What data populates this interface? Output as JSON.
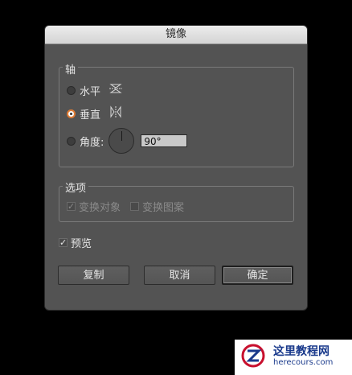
{
  "dialog": {
    "title": "镜像",
    "axis_group": {
      "title": "轴",
      "horizontal_label": "水平",
      "vertical_label": "垂直",
      "angle_label": "角度:",
      "angle_value": "90°",
      "selected": "vertical"
    },
    "options_group": {
      "title": "选项",
      "transform_objects_label": "变换对象",
      "transform_objects_checked": true,
      "transform_patterns_label": "变换图案",
      "transform_patterns_checked": false,
      "disabled": true
    },
    "preview_label": "预览",
    "preview_checked": true,
    "buttons": {
      "copy": "复制",
      "cancel": "取消",
      "ok": "确定"
    }
  },
  "watermark": {
    "title": "这里教程网",
    "url": "herecours.com"
  },
  "colors": {
    "dialog_bg": "#535353",
    "accent_radio": "#e07b33",
    "page_bg": "#000000"
  }
}
